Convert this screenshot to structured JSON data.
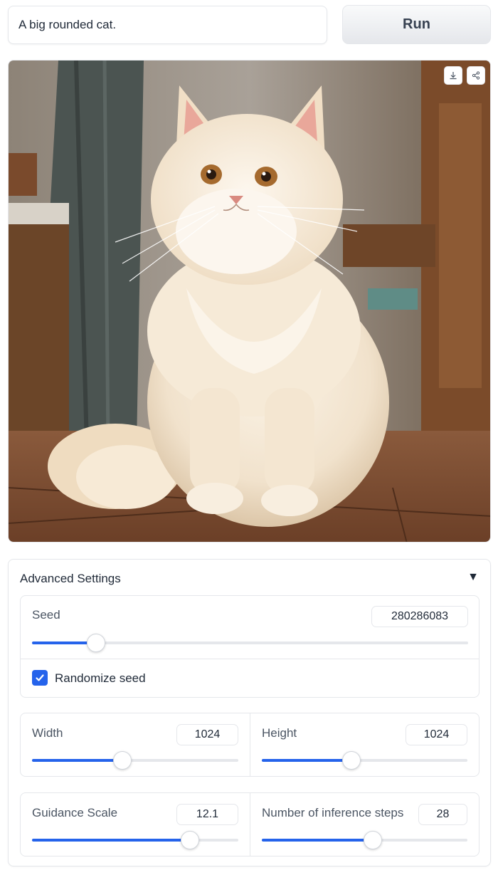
{
  "prompt": {
    "value": "A big rounded cat."
  },
  "run_button": {
    "label": "Run"
  },
  "image": {
    "icons": [
      "download-icon",
      "share-icon"
    ]
  },
  "advanced_settings": {
    "title": "Advanced Settings",
    "caret": "▼",
    "seed": {
      "label": "Seed",
      "value": "280286083",
      "fraction": 0.147
    },
    "randomize_seed": {
      "label": "Randomize seed",
      "checked": true
    },
    "width": {
      "label": "Width",
      "value": "1024",
      "fraction": 0.437
    },
    "height": {
      "label": "Height",
      "value": "1024",
      "fraction": 0.437
    },
    "guidance_scale": {
      "label": "Guidance Scale",
      "value": "12.1",
      "fraction": 0.766
    },
    "inference_steps": {
      "label": "Number of inference steps",
      "value": "28",
      "fraction": 0.54
    }
  },
  "colors": {
    "accent": "#2563eb",
    "border": "#e5e7eb"
  }
}
